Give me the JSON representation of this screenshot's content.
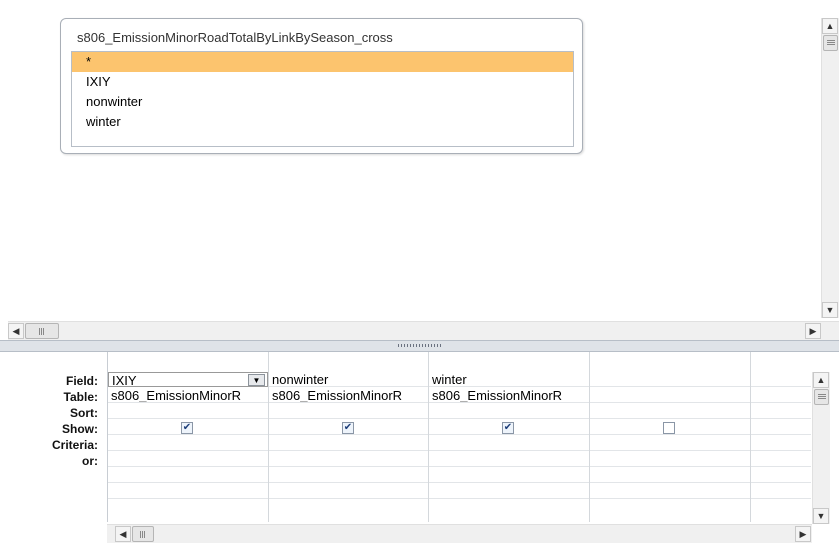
{
  "design_pane": {
    "table": {
      "title": "s806_EmissionMinorRoadTotalByLinkBySeason_cross",
      "fields": [
        "*",
        "IXIY",
        "nonwinter",
        "winter"
      ],
      "selected_index": 0
    }
  },
  "grid": {
    "row_labels": {
      "field": "Field:",
      "table": "Table:",
      "sort": "Sort:",
      "show": "Show:",
      "criteria": "Criteria:",
      "or": "or:"
    },
    "columns": [
      {
        "field": "IXIY",
        "table": "s806_EmissionMinorR",
        "sort": "",
        "show": true,
        "criteria": "",
        "or": ""
      },
      {
        "field": "nonwinter",
        "table": "s806_EmissionMinorR",
        "sort": "",
        "show": true,
        "criteria": "",
        "or": ""
      },
      {
        "field": "winter",
        "table": "s806_EmissionMinorR",
        "sort": "",
        "show": true,
        "criteria": "",
        "or": ""
      },
      {
        "field": "",
        "table": "",
        "sort": "",
        "show": false,
        "criteria": "",
        "or": ""
      },
      {
        "field": "",
        "table": "",
        "sort": "",
        "show": false,
        "criteria": "",
        "or": ""
      }
    ]
  },
  "icons": {
    "scroll_up": "scroll-up-arrow-icon",
    "scroll_down": "scroll-down-arrow-icon",
    "scroll_left": "scroll-left-arrow-icon",
    "scroll_right": "scroll-right-arrow-icon",
    "dropdown": "chevron-down-icon",
    "check": "checkmark-icon"
  },
  "colors": {
    "selected_field": "#fcc46e",
    "splitter": "#dfe3e8"
  }
}
